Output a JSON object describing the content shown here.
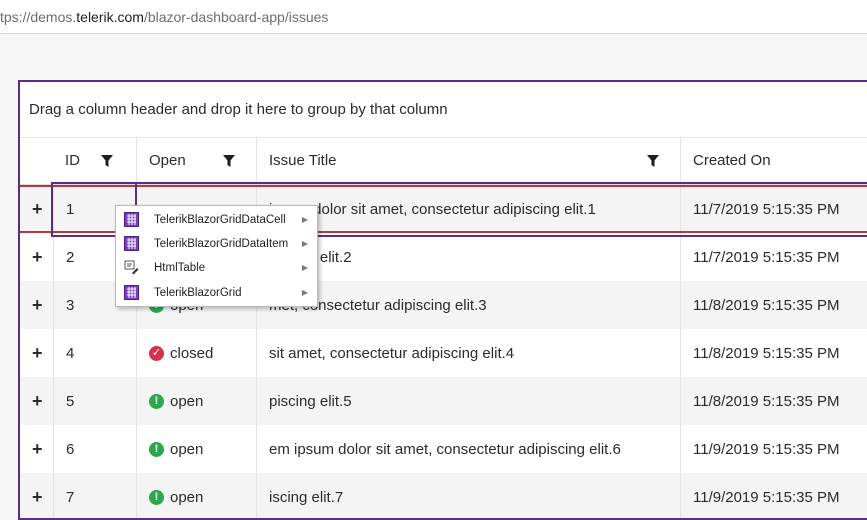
{
  "browser": {
    "url_prefix": "tps://demos.",
    "url_host": "telerik.com",
    "url_path": "/blazor-dashboard-app/issues"
  },
  "grid": {
    "group_panel_text": "Drag a column header and drop it here to group by that column",
    "columns": [
      {
        "label": "ID",
        "filter": true
      },
      {
        "label": "Open",
        "filter": true
      },
      {
        "label": "Issue Title",
        "filter": true
      },
      {
        "label": "Created On",
        "filter": false
      }
    ],
    "rows": [
      {
        "expand": "+",
        "id": "1",
        "status": "",
        "status_type": "none",
        "title": "ipsum dolor sit amet, consectetur adipiscing elit.1",
        "created": "11/7/2019 5:15:35 PM"
      },
      {
        "expand": "+",
        "id": "2",
        "status": "",
        "status_type": "none",
        "title": "piscing elit.2",
        "created": "11/7/2019 5:15:35 PM"
      },
      {
        "expand": "+",
        "id": "3",
        "status": "open",
        "status_type": "open",
        "title": "met, consectetur adipiscing elit.3",
        "created": "11/8/2019 5:15:35 PM"
      },
      {
        "expand": "+",
        "id": "4",
        "status": "closed",
        "status_type": "closed",
        "title": "sit amet, consectetur adipiscing elit.4",
        "created": "11/8/2019 5:15:35 PM"
      },
      {
        "expand": "+",
        "id": "5",
        "status": "open",
        "status_type": "open",
        "title": "piscing elit.5",
        "created": "11/8/2019 5:15:35 PM"
      },
      {
        "expand": "+",
        "id": "6",
        "status": "open",
        "status_type": "open",
        "title": "em ipsum dolor sit amet, consectetur adipiscing elit.6",
        "created": "11/9/2019 5:15:35 PM"
      },
      {
        "expand": "+",
        "id": "7",
        "status": "open",
        "status_type": "open",
        "title": "iscing elit.7",
        "created": "11/9/2019 5:15:35 PM"
      }
    ]
  },
  "context_menu": {
    "items": [
      {
        "label": "TelerikBlazorGridDataCell",
        "icon": "component-grid-icon"
      },
      {
        "label": "TelerikBlazorGridDataItem",
        "icon": "component-grid-icon"
      },
      {
        "label": "HtmlTable",
        "icon": "html-element-icon"
      },
      {
        "label": "TelerikBlazorGrid",
        "icon": "component-grid-icon"
      }
    ],
    "arrow": "▶"
  },
  "colors": {
    "accent": "#5b2c8e",
    "selected_border": "#b73838",
    "open": "#2aa84a",
    "closed": "#d6304a",
    "component_icon": "#7b3fc6"
  }
}
